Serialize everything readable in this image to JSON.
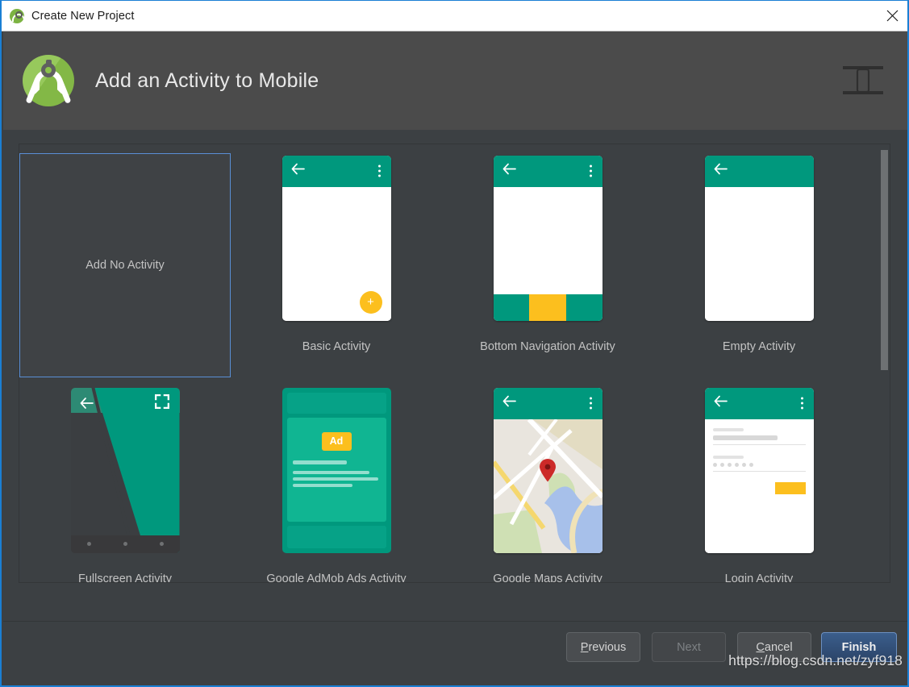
{
  "window": {
    "title": "Create New Project",
    "app_icon": "android-studio-icon",
    "close_icon": "close-icon"
  },
  "header": {
    "logo": "android-studio-logo",
    "title": "Add an Activity to Mobile",
    "form_factor_icon": "mobile-device-icon"
  },
  "colors": {
    "dialog_bg": "#3c4043",
    "header_bg": "#4b4b4b",
    "selection_border": "#5a8fd6",
    "accent_teal": "#00987d",
    "accent_amber": "#fcbf1e",
    "finish_blue": "#3b5e8c",
    "text_primary": "#c3c3c3",
    "logo_green": "#8bc34a",
    "map_pin_red": "#cc2a28"
  },
  "templates": [
    {
      "id": "no-activity",
      "label": "Add No Activity",
      "art": "empty-selection-box",
      "selected": true
    },
    {
      "id": "basic",
      "label": "Basic Activity",
      "art": "phone-appbar-fab",
      "selected": false
    },
    {
      "id": "bottom-navigation",
      "label": "Bottom Navigation Activity",
      "art": "phone-bottom-nav",
      "selected": false
    },
    {
      "id": "empty",
      "label": "Empty Activity",
      "art": "phone-appbar-plain",
      "selected": false
    },
    {
      "id": "fullscreen",
      "label": "Fullscreen Activity",
      "art": "phone-fullscreen",
      "selected": false
    },
    {
      "id": "admob",
      "label": "Google AdMob Ads Activity",
      "art": "phone-ad-card",
      "selected": false
    },
    {
      "id": "maps",
      "label": "Google Maps Activity",
      "art": "phone-map-pin",
      "selected": false
    },
    {
      "id": "login",
      "label": "Login Activity",
      "art": "phone-login-form",
      "selected": false
    }
  ],
  "admob": {
    "badge": "Ad"
  },
  "scrollbar": {
    "orientation": "vertical",
    "thumb_at_top": true
  },
  "footer": {
    "previous": {
      "label": "Previous",
      "accel": "P",
      "enabled": true
    },
    "next": {
      "label": "Next",
      "accel": "",
      "enabled": false
    },
    "cancel": {
      "label": "Cancel",
      "accel": "C",
      "enabled": true
    },
    "finish": {
      "label": "Finish",
      "accel": "",
      "enabled": true,
      "default": true
    }
  },
  "watermark": {
    "text": "https://blog.csdn.net/zyf918"
  }
}
